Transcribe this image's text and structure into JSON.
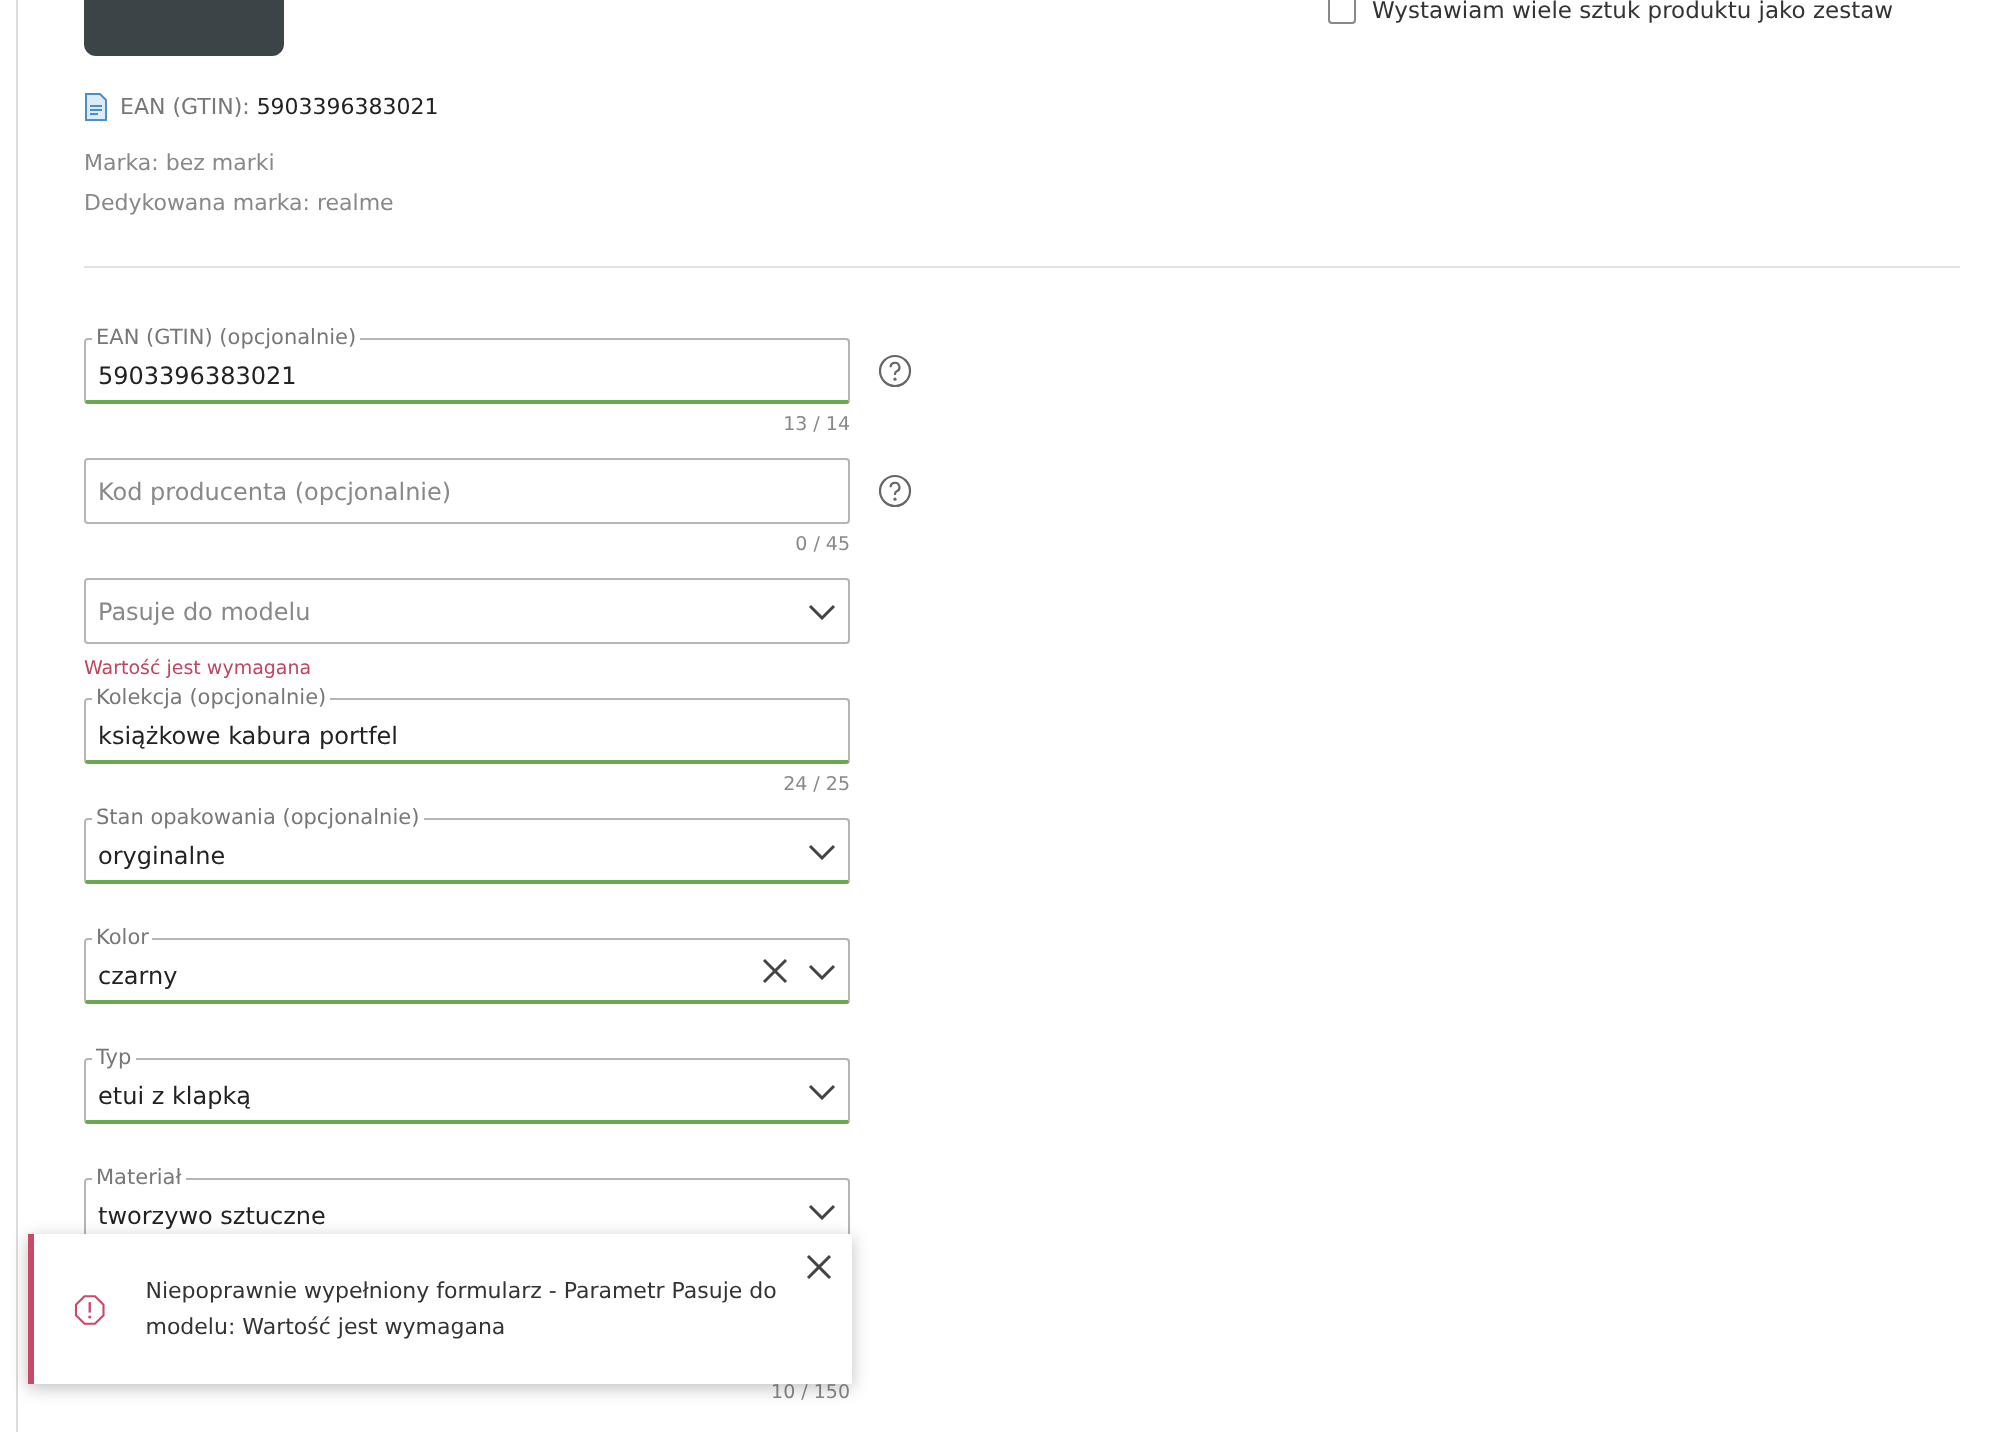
{
  "set_option": {
    "label": "Wystawiam wiele sztuk produktu jako zestaw",
    "checked": false
  },
  "product": {
    "ean_label": "EAN (GTIN):",
    "ean_value": "5903396383021",
    "brand": "Marka: bez marki",
    "dedicated_brand": "Dedykowana marka: realme"
  },
  "fields": [
    {
      "kind": "text",
      "label": "EAN (GTIN) (opcjonalnie)",
      "value": "5903396383021",
      "counter": "13 / 14",
      "help": true,
      "valid": true,
      "clearable": false
    },
    {
      "kind": "text",
      "placeholder": "Kod producenta (opcjonalnie)",
      "counter": "0 / 45",
      "help": true,
      "valid": false,
      "clearable": false
    },
    {
      "kind": "select",
      "placeholder": "Pasuje do modelu",
      "error": "Wartość jest wymagana",
      "help": false,
      "valid": false,
      "clearable": false
    },
    {
      "kind": "text",
      "label": "Kolekcja (opcjonalnie)",
      "value": "książkowe kabura portfel",
      "counter": "24 / 25",
      "help": false,
      "valid": true,
      "clearable": false
    },
    {
      "kind": "select",
      "label": "Stan opakowania (opcjonalnie)",
      "value": "oryginalne",
      "help": false,
      "valid": true,
      "clearable": false
    },
    {
      "kind": "select",
      "label": "Kolor",
      "value": "czarny",
      "help": false,
      "valid": true,
      "clearable": true
    },
    {
      "kind": "select",
      "label": "Typ",
      "value": "etui z klapką",
      "help": false,
      "valid": true,
      "clearable": false
    },
    {
      "kind": "select",
      "label": "Materiał",
      "value": "tworzywo sztuczne",
      "help": false,
      "clearable": false
    }
  ],
  "covered_field_counter": "10 / 150",
  "toast": {
    "message": "Niepoprawnie wypełniony formularz - Parametr Pasuje do modelu: Wartość jest wymagana"
  }
}
